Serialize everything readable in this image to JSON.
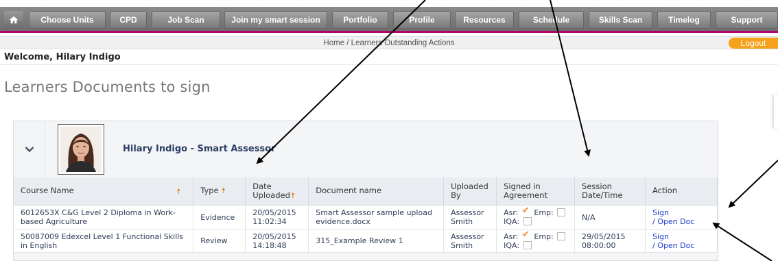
{
  "nav": {
    "home_icon": "home-icon",
    "items": [
      {
        "label": "Choose Units"
      },
      {
        "label": "CPD"
      },
      {
        "label": "Job Scan"
      },
      {
        "label": "Join my smart session"
      },
      {
        "label": "Portfolio"
      },
      {
        "label": "Profile"
      },
      {
        "label": "Resources"
      },
      {
        "label": "Schedule"
      },
      {
        "label": "Skills Scan"
      },
      {
        "label": "Timelog"
      },
      {
        "label": "Support"
      }
    ],
    "accent_color": "#b3006b"
  },
  "breadcrumb": "Home / Learners Outstanding Actions",
  "logout_label": "Logout",
  "welcome": "Welcome, Hilary Indigo",
  "page_title": "Learners Documents to sign",
  "learner": {
    "name": "Hilary Indigo - Smart Assessor",
    "expand_icon": "chevron-down-icon"
  },
  "table": {
    "headers": {
      "course": "Course Name",
      "type": "Type",
      "date_line1": "Date",
      "date_line2": "Uploaded",
      "document": "Document name",
      "uploaded_line1": "Uploaded",
      "uploaded_line2": "By",
      "signed_line1": "Signed in",
      "signed_line2": "Agreement",
      "session_line1": "Session",
      "session_line2": "Date/Time",
      "action": "Action"
    },
    "sig_labels": {
      "asr": "Asr:",
      "emp": "Emp:",
      "iqa": "IQA:"
    },
    "rows": [
      {
        "course": "6012653X C&G Level 2 Diploma in Work-based Agriculture",
        "type": "Evidence",
        "date": "20/05/2015",
        "time": "11:02:34",
        "document": "Smart Assessor sample upload evidence.docx",
        "uploaded_line1": "Assessor",
        "uploaded_line2": "Smith",
        "session": "N/A",
        "session_time": "",
        "sign_label": "Sign",
        "open_label": "/ Open Doc"
      },
      {
        "course": "50087009 Edexcel Level 1 Functional Skills in English",
        "type": "Review",
        "date": "20/05/2015",
        "time": "14:18:48",
        "document": "315_Example Review 1",
        "uploaded_line1": "Assessor",
        "uploaded_line2": "Smith",
        "session": "29/05/2015",
        "session_time": "08:00:00",
        "sign_label": "Sign",
        "open_label": "/ Open Doc"
      }
    ]
  },
  "colors": {
    "sort_arrow": "#e07a16",
    "link": "#1a3ccf",
    "logout": "#f5a11a",
    "check": "#f08c1a"
  }
}
